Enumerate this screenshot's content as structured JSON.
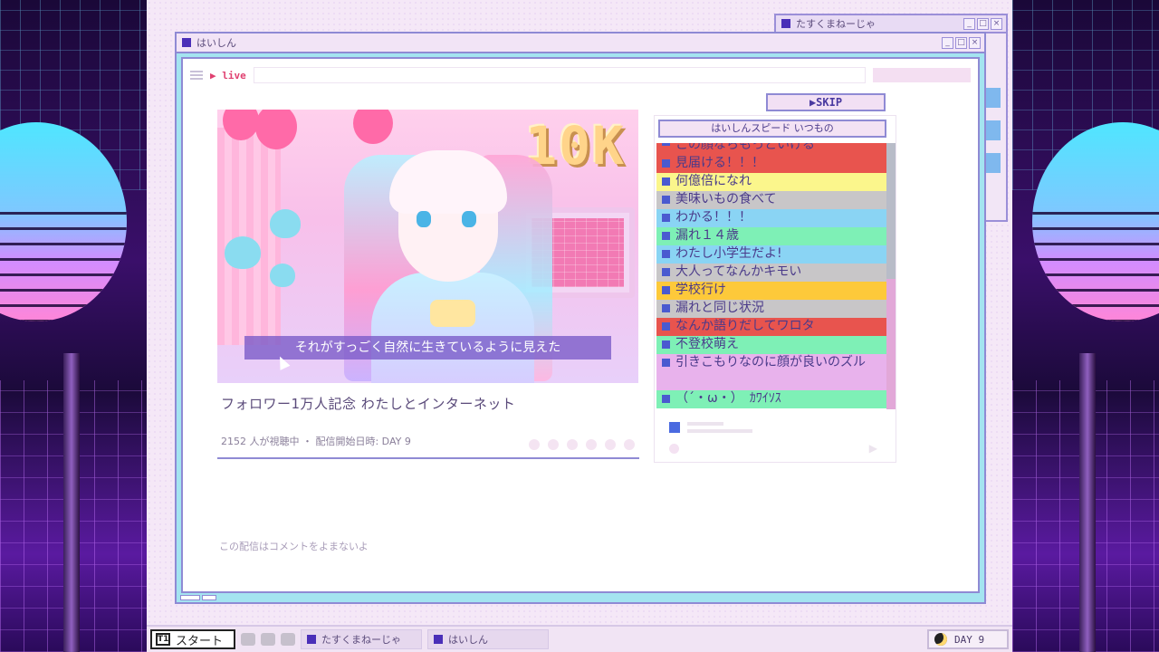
{
  "bg_window": {
    "title": "たすくまねーじゃ"
  },
  "main_window": {
    "title": "はいしん"
  },
  "toolbar": {
    "live_label": "▶ live"
  },
  "skip_button": "▶SKIP",
  "video": {
    "overlay_text": "10K",
    "subtitle": "それがすっごく自然に生きているように見えた"
  },
  "stream": {
    "title": "フォロワー1万人記念 わたしとインターネット",
    "meta": "2152 人が視聴中 ・ 配信開始日時: DAY 9",
    "no_comment_note": "この配信はコメントをよまないよ"
  },
  "chat": {
    "title": "はいしんスピード いつもの",
    "messages": [
      {
        "text": "この顔ならもっといける",
        "color": "#e8544e"
      },
      {
        "text": "見届ける！！！",
        "color": "#e8544e"
      },
      {
        "text": "何億倍になれ",
        "color": "#fbf68c"
      },
      {
        "text": "美味いもの食べて",
        "color": "#c8c6c8"
      },
      {
        "text": "わかる！！！",
        "color": "#8ad4f4"
      },
      {
        "text": "漏れ１４歳",
        "color": "#7ef0b6"
      },
      {
        "text": "わたし小学生だよ!",
        "color": "#8ad4f4"
      },
      {
        "text": "大人ってなんかキモい",
        "color": "#c8c6c8"
      },
      {
        "text": "学校行け",
        "color": "#fdc93a"
      },
      {
        "text": "漏れと同じ状況",
        "color": "#c8c6c8"
      },
      {
        "text": "なんか語りだしてワロタ",
        "color": "#e8544e"
      },
      {
        "text": "不登校萌え",
        "color": "#7ef0b6"
      },
      {
        "text": "引きこもりなのに顔が良いのズル",
        "color": "#e8b2ec"
      },
      {
        "text": "（´・ω・）　ｶﾜｲｿｽ",
        "color": "#7ef0b6"
      }
    ]
  },
  "taskbar": {
    "start_logo": "T1",
    "start_label": "スタート",
    "tasks": [
      "たすくまねーじゃ",
      "はいしん"
    ],
    "day_label": "DAY 9"
  },
  "colors": {
    "accent": "#8f8ad4",
    "window_frame": "#a4e4f0",
    "desktop": "#f5e8f7"
  }
}
